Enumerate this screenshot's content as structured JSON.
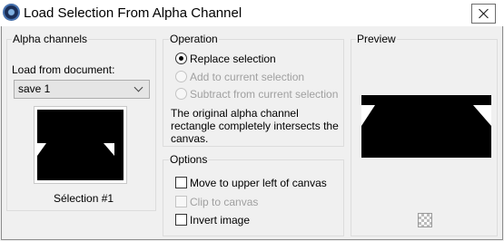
{
  "window": {
    "title": "Load Selection From Alpha Channel",
    "app_icon": "app-icon",
    "close_icon": "close-icon"
  },
  "alpha_channels": {
    "group_label": "Alpha channels",
    "load_from_label": "Load from document:",
    "document_value": "save 1",
    "thumbnail_caption": "Sélection #1"
  },
  "operation": {
    "group_label": "Operation",
    "options": [
      {
        "label": "Replace selection",
        "selected": true,
        "enabled": true
      },
      {
        "label": "Add to current selection",
        "selected": false,
        "enabled": false
      },
      {
        "label": "Subtract from current selection",
        "selected": false,
        "enabled": false
      }
    ],
    "info": "The original alpha channel rectangle completely intersects the canvas."
  },
  "options": {
    "group_label": "Options",
    "items": [
      {
        "label": "Move to upper left of canvas",
        "checked": false,
        "enabled": true
      },
      {
        "label": "Clip to canvas",
        "checked": false,
        "enabled": false
      },
      {
        "label": "Invert image",
        "checked": false,
        "enabled": true
      }
    ]
  },
  "preview": {
    "group_label": "Preview",
    "transparency_icon": "checkerboard-icon"
  }
}
